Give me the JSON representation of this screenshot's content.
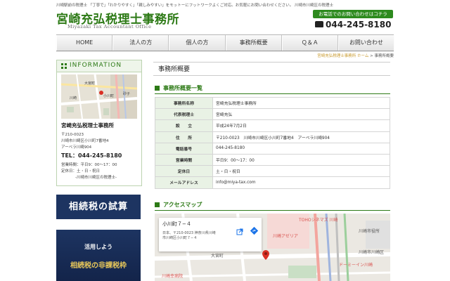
{
  "header": {
    "tagline": "川崎駅前の税理士 「丁寧で」「わかりやすく」「親しみやすい」をモットーにフットワークよくご対応。お気軽にお問い合わせください。 川崎市川崎区の税理士",
    "site_title": "宮崎充弘税理士事務所",
    "site_subtitle": "Miyazaki Tax Accountant Office",
    "contact_banner": "お電話でのお問い合わせはコチラ",
    "phone": "044-245-8180"
  },
  "nav": {
    "items": [
      {
        "label": "HOME"
      },
      {
        "label": "法人の方"
      },
      {
        "label": "個人の方"
      },
      {
        "label": "事務所概要"
      },
      {
        "label": "Ｑ＆Ａ"
      },
      {
        "label": "お問い合わせ"
      }
    ]
  },
  "breadcrumb": {
    "home": "宮崎充弘税理士事務所 ホーム",
    "separator": " > ",
    "current": "事務所概要"
  },
  "sidebar": {
    "info_title": "INFORMATION",
    "name": "宮崎充弘税理士事務所",
    "postal": "〒210-0023",
    "address1": "川崎市川崎区小川町7番地4",
    "address2": "アーベラ川崎904",
    "tel": "TEL：044-245-8180",
    "hours": "営業時間：平日9：00〜17：00",
    "holidays": "定休日：土・日・祝日",
    "footer_note": "-川崎市川崎区の税理士-",
    "map_labels": [
      "大宮町",
      "小川町",
      "砂子",
      "川崎"
    ],
    "banner1": "相続税の試算",
    "banner2_line1": "活用しよう",
    "banner2_line2": "相続税の非課税枠"
  },
  "main": {
    "page_title": "事務所概要",
    "section1_title": "事務所概要一覧",
    "profile_rows": [
      {
        "label": "事務所名称",
        "value": "宮崎充弘税理士事務所"
      },
      {
        "label": "代表税理士",
        "value": "宮崎充弘"
      },
      {
        "label": "設　　立",
        "value": "平成24年7月2日"
      },
      {
        "label": "住　　所",
        "value": "〒210-0023　川崎市川崎区小川町7番地4　アーベラ川崎904"
      },
      {
        "label": "電話番号",
        "value": "044-245-8180"
      },
      {
        "label": "営業時間",
        "value": "平日9：00〜17：00"
      },
      {
        "label": "定休日",
        "value": "土・日・祝日"
      },
      {
        "label": "メールアドレス",
        "value": "info@miya-tax.com"
      }
    ],
    "section2_title": "アクセスマップ",
    "map": {
      "card_title": "小川町７−４",
      "card_address1": "日本、〒210-0023 神奈川県川崎",
      "card_address2": "市川崎区小川町７−４",
      "labels": [
        "TOHOシネマズ 川崎",
        "川崎市役所",
        "川崎アゼリア",
        "大宮町",
        "川崎幸病院",
        "川崎市川崎区",
        "ドーミーイン川崎"
      ]
    }
  },
  "colors": {
    "brand_green": "#2d7a16",
    "banner_navy": "#1d3461",
    "gold": "#e8c85a"
  }
}
